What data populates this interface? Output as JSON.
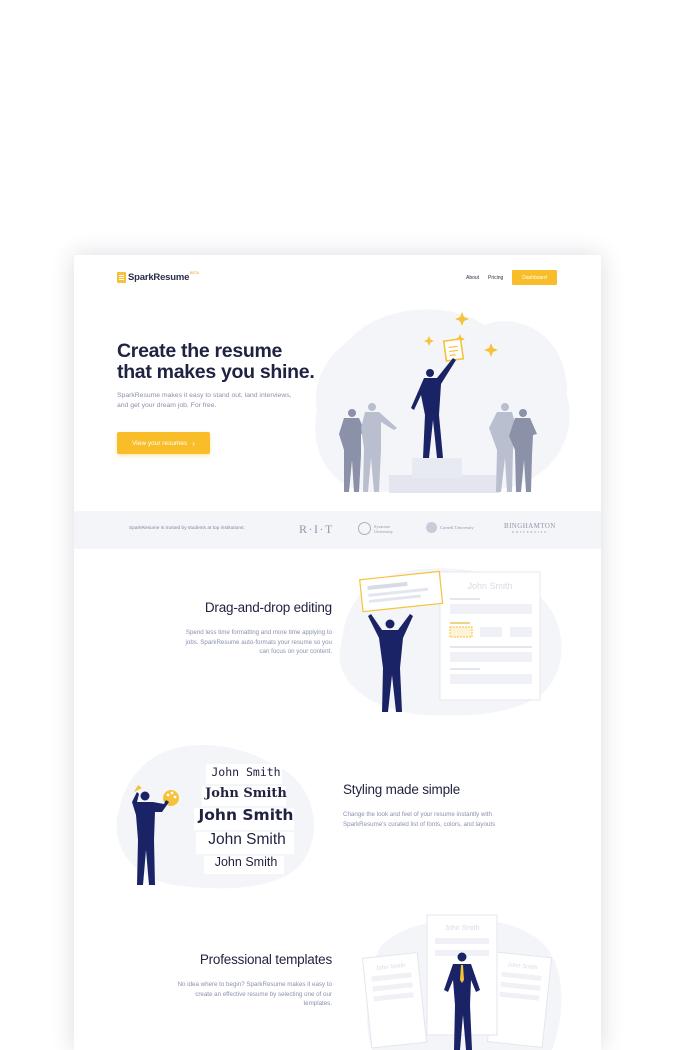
{
  "nav": {
    "brand": "SparkResume",
    "beta_tag": "BETA",
    "links": [
      "About",
      "Pricing"
    ],
    "dashboard_label": "Dashboard"
  },
  "hero": {
    "title_line1": "Create the resume",
    "title_line2": "that makes you shine.",
    "subtitle": "SparkResume makes it easy to stand out, land interviews, and get your dream job. For free.",
    "cta_label": "View your resumes"
  },
  "trust": {
    "text": "SparkResume is trusted by students at top institutions:",
    "logos": [
      "R·I·T",
      "Syracuse",
      "University",
      "Cornell University",
      "BINGHAMTON",
      "UNIVERSITY"
    ]
  },
  "features": [
    {
      "title": "Drag-and-drop editing",
      "body": "Spend less time formatting and more time applying to jobs. SparkResume auto-formats your resume so you can focus on your content."
    },
    {
      "title": "Styling made simple",
      "body": "Change the look and feel of your resume instantly with SparkResume's curated list of fonts, colors, and layouts"
    },
    {
      "title": "Professional templates",
      "body": "No idea where to begin? SparkResume makes it easy to create an effective resume by selecting one of our templates."
    }
  ],
  "illustrations": {
    "resume_name": "John Smith",
    "font_samples": [
      "John Smith",
      "John Smith",
      "John Smith",
      "John Smith",
      "John Smith"
    ]
  },
  "colors": {
    "accent": "#f8bd29",
    "navy": "#1a2366",
    "text_dark": "#1f2240",
    "text_muted": "#8a92ad",
    "band_bg": "#f4f5f8"
  }
}
